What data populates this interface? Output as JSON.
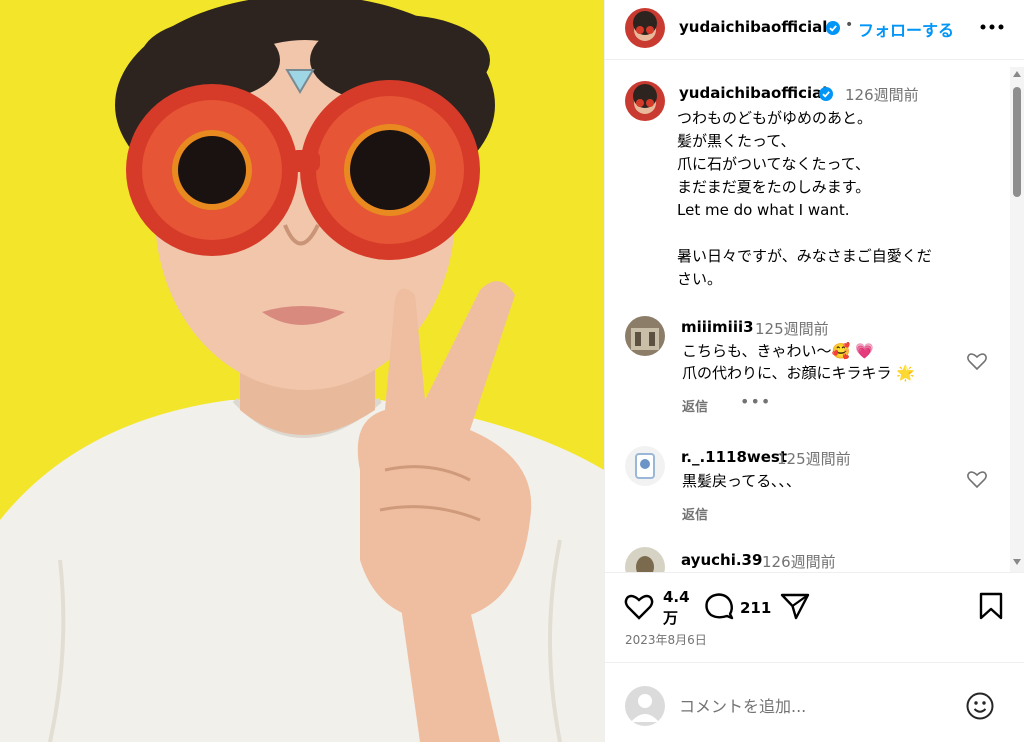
{
  "post": {
    "username": "yudaichibaofficial",
    "follow_label": "フォローする",
    "dot": "•",
    "verified": true
  },
  "caption": {
    "username": "yudaichibaofficial",
    "time": "126週間前",
    "text": "つわものどもがゆめのあと。\n髪が黒くたって、\n爪に石がついてなくたって、\nまだまだ夏をたのしみます。\nLet me do what I want.\n\n暑い日々ですが、みなさまご自愛くだ\nさい。"
  },
  "comments": [
    {
      "username": "miiimiii3",
      "time": "125週間前",
      "lines": [
        "こちらも、きゃわい〜🥰 💗",
        "爪の代わりに、お顔にキラキラ 🌟"
      ],
      "reply_label": "返信",
      "more_label": "•••"
    },
    {
      "username": "r._.1118west",
      "time": "125週間前",
      "lines": [
        "黒髪戻ってる､､､"
      ],
      "reply_label": "返信"
    },
    {
      "username": "ayuchi.39",
      "time": "126週間前"
    }
  ],
  "actions": {
    "likes": "4.4\n万",
    "comments": "211",
    "date": "2023年8月6日"
  },
  "comment_box": {
    "placeholder": "コメントを追加..."
  },
  "colors": {
    "accent": "#0095f6",
    "verified": "#0095f6",
    "photo_background": "#f4e82a",
    "secondary_text": "#737373"
  },
  "icons": {
    "like": "heart-icon",
    "comment": "speech-bubble-icon",
    "share": "paper-plane-icon",
    "save": "bookmark-icon",
    "emoji": "smiley-icon",
    "more": "ellipsis-icon"
  }
}
